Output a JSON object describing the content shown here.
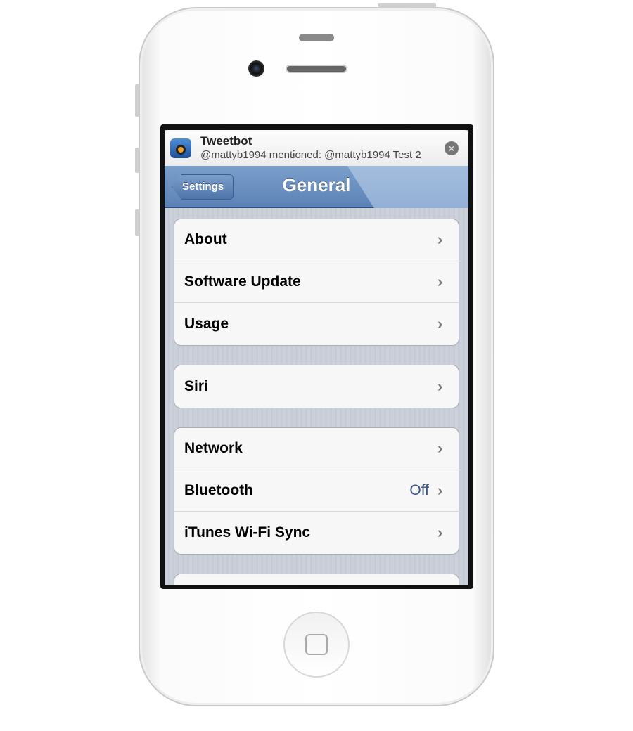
{
  "notification": {
    "app": "Tweetbot",
    "message": "@mattyb1994 mentioned: @mattyb1994 Test 2",
    "close_icon": "close-circle-icon",
    "app_icon": "tweetbot-icon"
  },
  "navbar": {
    "back_label": "Settings",
    "title": "General"
  },
  "groups": [
    [
      {
        "label": "About"
      },
      {
        "label": "Software Update"
      },
      {
        "label": "Usage"
      }
    ],
    [
      {
        "label": "Siri"
      }
    ],
    [
      {
        "label": "Network"
      },
      {
        "label": "Bluetooth",
        "value": "Off"
      },
      {
        "label": "iTunes Wi-Fi Sync"
      }
    ]
  ],
  "colors": {
    "navbar": "#6a8fc2",
    "value_text": "#385487",
    "background": "#cbd0da"
  }
}
